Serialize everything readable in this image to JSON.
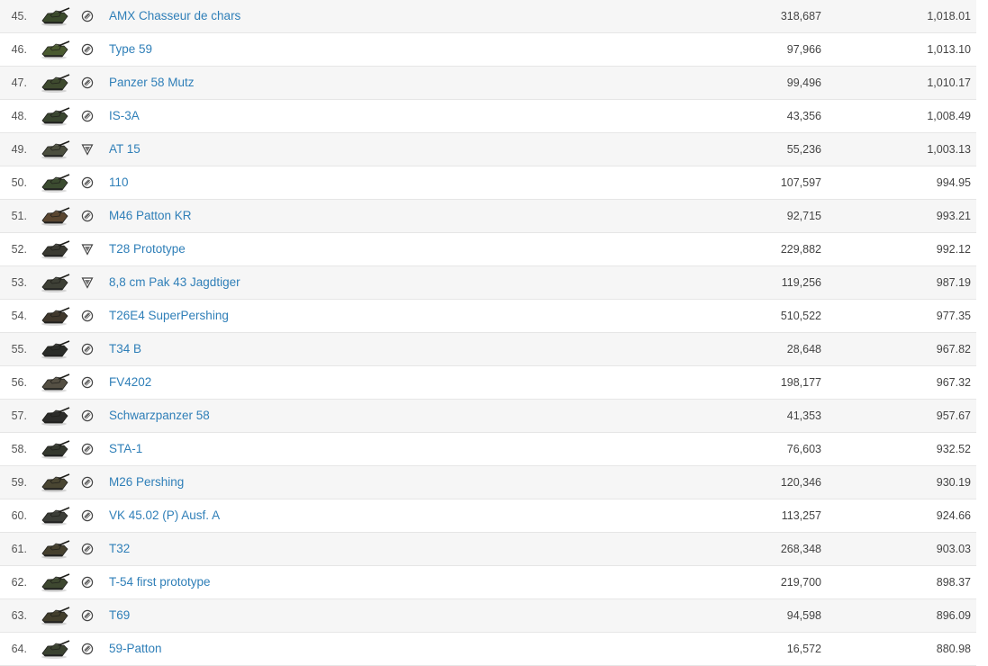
{
  "rows": [
    {
      "rank": "45.",
      "name": "AMX Chasseur de chars",
      "battles": "318,687",
      "value": "1,018.01",
      "tank_color": "#3b4a2c",
      "badge": "round"
    },
    {
      "rank": "46.",
      "name": "Type 59",
      "battles": "97,966",
      "value": "1,013.10",
      "tank_color": "#4a5a30",
      "badge": "round"
    },
    {
      "rank": "47.",
      "name": "Panzer 58 Mutz",
      "battles": "99,496",
      "value": "1,010.17",
      "tank_color": "#3e4a2e",
      "badge": "round"
    },
    {
      "rank": "48.",
      "name": "IS-3A",
      "battles": "43,356",
      "value": "1,008.49",
      "tank_color": "#3a4630",
      "badge": "round"
    },
    {
      "rank": "49.",
      "name": "AT 15",
      "battles": "55,236",
      "value": "1,003.13",
      "tank_color": "#4b4e3e",
      "badge": "shield"
    },
    {
      "rank": "50.",
      "name": "110",
      "battles": "107,597",
      "value": "994.95",
      "tank_color": "#3c4c30",
      "badge": "round"
    },
    {
      "rank": "51.",
      "name": "M46 Patton KR",
      "battles": "92,715",
      "value": "993.21",
      "tank_color": "#5a4630",
      "badge": "round"
    },
    {
      "rank": "52.",
      "name": "T28 Prototype",
      "battles": "229,882",
      "value": "992.12",
      "tank_color": "#3a3a32",
      "badge": "shield"
    },
    {
      "rank": "53.",
      "name": "8,8 cm Pak 43 Jagdtiger",
      "battles": "119,256",
      "value": "987.19",
      "tank_color": "#3e4036",
      "badge": "shield"
    },
    {
      "rank": "54.",
      "name": "T26E4 SuperPershing",
      "battles": "510,522",
      "value": "977.35",
      "tank_color": "#40382c",
      "badge": "round"
    },
    {
      "rank": "55.",
      "name": "T34 B",
      "battles": "28,648",
      "value": "967.82",
      "tank_color": "#2a2c28",
      "badge": "round"
    },
    {
      "rank": "56.",
      "name": "FV4202",
      "battles": "198,177",
      "value": "967.32",
      "tank_color": "#555044",
      "badge": "round"
    },
    {
      "rank": "57.",
      "name": "Schwarzpanzer 58",
      "battles": "41,353",
      "value": "957.67",
      "tank_color": "#2c2c2a",
      "badge": "round"
    },
    {
      "rank": "58.",
      "name": "STA-1",
      "battles": "76,603",
      "value": "932.52",
      "tank_color": "#34382e",
      "badge": "round"
    },
    {
      "rank": "59.",
      "name": "M26 Pershing",
      "battles": "120,346",
      "value": "930.19",
      "tank_color": "#4a4632",
      "badge": "round"
    },
    {
      "rank": "60.",
      "name": "VK 45.02 (P) Ausf. A",
      "battles": "113,257",
      "value": "924.66",
      "tank_color": "#3c3e38",
      "badge": "round"
    },
    {
      "rank": "61.",
      "name": "T32",
      "battles": "268,348",
      "value": "903.03",
      "tank_color": "#45402e",
      "badge": "round"
    },
    {
      "rank": "62.",
      "name": "T-54 first prototype",
      "battles": "219,700",
      "value": "898.37",
      "tank_color": "#3e4830",
      "badge": "round"
    },
    {
      "rank": "63.",
      "name": "T69",
      "battles": "94,598",
      "value": "896.09",
      "tank_color": "#423e2c",
      "badge": "round"
    },
    {
      "rank": "64.",
      "name": "59-Patton",
      "battles": "16,572",
      "value": "880.98",
      "tank_color": "#3a4230",
      "badge": "round"
    }
  ]
}
